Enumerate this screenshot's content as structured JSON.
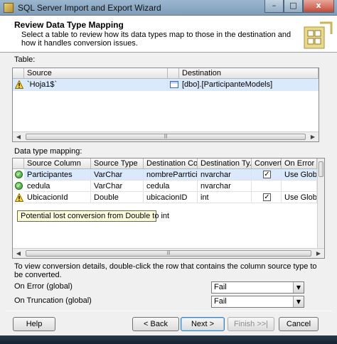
{
  "window": {
    "title": "SQL Server Import and Export Wizard",
    "controls": {
      "minimize": "–",
      "maximize": "□",
      "close": "x"
    }
  },
  "header": {
    "title": "Review Data Type Mapping",
    "description": "Select a table to review how its data types map to those in the destination and how it handles conversion issues."
  },
  "table_section": {
    "label": "Table:",
    "columns": [
      "Source",
      "Destination"
    ],
    "rows": [
      {
        "status": "warning",
        "source": "`Hoja1$`",
        "destination": "[dbo].[ParticipanteModels]"
      }
    ]
  },
  "mapping_section": {
    "label": "Data type mapping:",
    "columns": [
      "Source Column",
      "Source Type",
      "Destination Co...",
      "Destination Ty...",
      "Convert",
      "On Error"
    ],
    "rows": [
      {
        "status": "ok",
        "source_column": "Participantes",
        "source_type": "VarChar",
        "destination_column": "nombreParrtici...",
        "destination_type": "nvarchar",
        "convert": true,
        "on_error": "Use Global"
      },
      {
        "status": "ok",
        "source_column": "cedula",
        "source_type": "VarChar",
        "destination_column": "cedula",
        "destination_type": "nvarchar",
        "convert": false,
        "on_error": ""
      },
      {
        "status": "warning",
        "source_column": "UbicacionId",
        "source_type": "Double",
        "destination_column": "ubicacionID",
        "destination_type": "int",
        "convert": true,
        "on_error": "Use Global"
      }
    ],
    "tooltip": "Potential lost conversion from Double to int"
  },
  "hint": "To view conversion details, double-click the row that contains the column source type to be converted.",
  "options": {
    "on_error": {
      "label": "On Error (global)",
      "value": "Fail"
    },
    "on_truncation": {
      "label": "On Truncation (global)",
      "value": "Fail"
    }
  },
  "buttons": {
    "help": "Help",
    "back": "< Back",
    "next": "Next >",
    "finish": "Finish >>|",
    "cancel": "Cancel"
  },
  "colors": {
    "selection": "#dae9fb",
    "tooltip_bg": "#ffffe1",
    "title_bar": "#8fabc6"
  }
}
